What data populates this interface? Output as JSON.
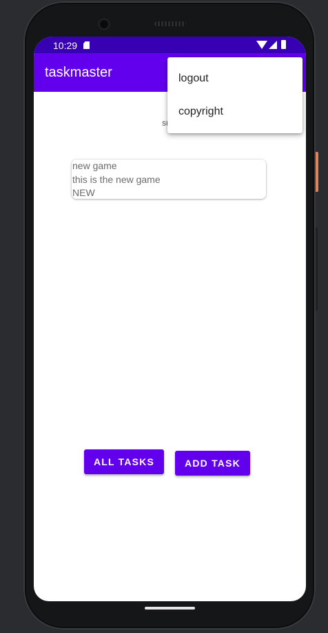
{
  "status_bar": {
    "time": "10:29",
    "icons": [
      "sd-card-icon",
      "wifi-icon",
      "signal-icon",
      "battery-icon"
    ]
  },
  "app_bar": {
    "title": "taskmaster",
    "color": "#6200ee"
  },
  "overflow_menu": {
    "items": [
      {
        "label": "logout"
      },
      {
        "label": "copyright"
      }
    ]
  },
  "main": {
    "username_partial": "su",
    "task": {
      "title": "new game",
      "body": "this is the new game",
      "state": "NEW"
    }
  },
  "buttons": {
    "all_tasks": "ALL TASKS",
    "add_task": "ADD TASK"
  },
  "colors": {
    "status_bar": "#3700b3",
    "primary": "#6200ee",
    "text_secondary": "#6b6b6b"
  }
}
